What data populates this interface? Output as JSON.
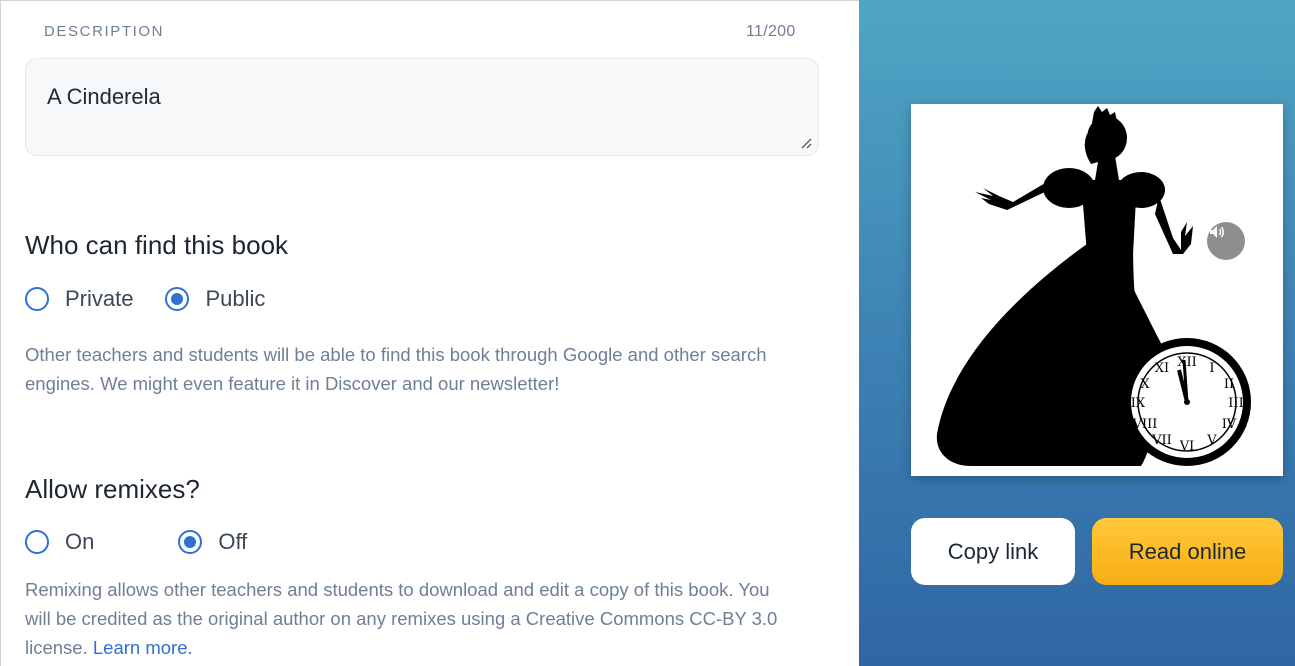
{
  "description": {
    "label": "DESCRIPTION",
    "counter": "11/200",
    "value": "A Cinderela"
  },
  "visibility": {
    "heading": "Who can find this book",
    "options": [
      {
        "label": "Private",
        "selected": false
      },
      {
        "label": "Public",
        "selected": true
      }
    ],
    "help": "Other teachers and students will be able to find this book through Google and other search engines. We might even feature it in Discover and our newsletter!"
  },
  "remixes": {
    "heading": "Allow remixes?",
    "options": [
      {
        "label": "On",
        "selected": false
      },
      {
        "label": "Off",
        "selected": true
      }
    ],
    "help": "Remixing allows other teachers and students to download and edit a copy of this book. You will be credited as the original author on any remixes using a Creative Commons CC-BY 3.0 license.",
    "learn_more": "Learn more."
  },
  "preview": {
    "cover_alt": "cinderella-silhouette-with-clock",
    "audio_icon": "speaker-icon",
    "copy_link_label": "Copy link",
    "read_online_label": "Read online"
  },
  "colors": {
    "accent": "#2f6fd6",
    "read_button": "#f7ad12",
    "panel_gradient_top": "#4fa6c4",
    "panel_gradient_bottom": "#2f66a3"
  }
}
